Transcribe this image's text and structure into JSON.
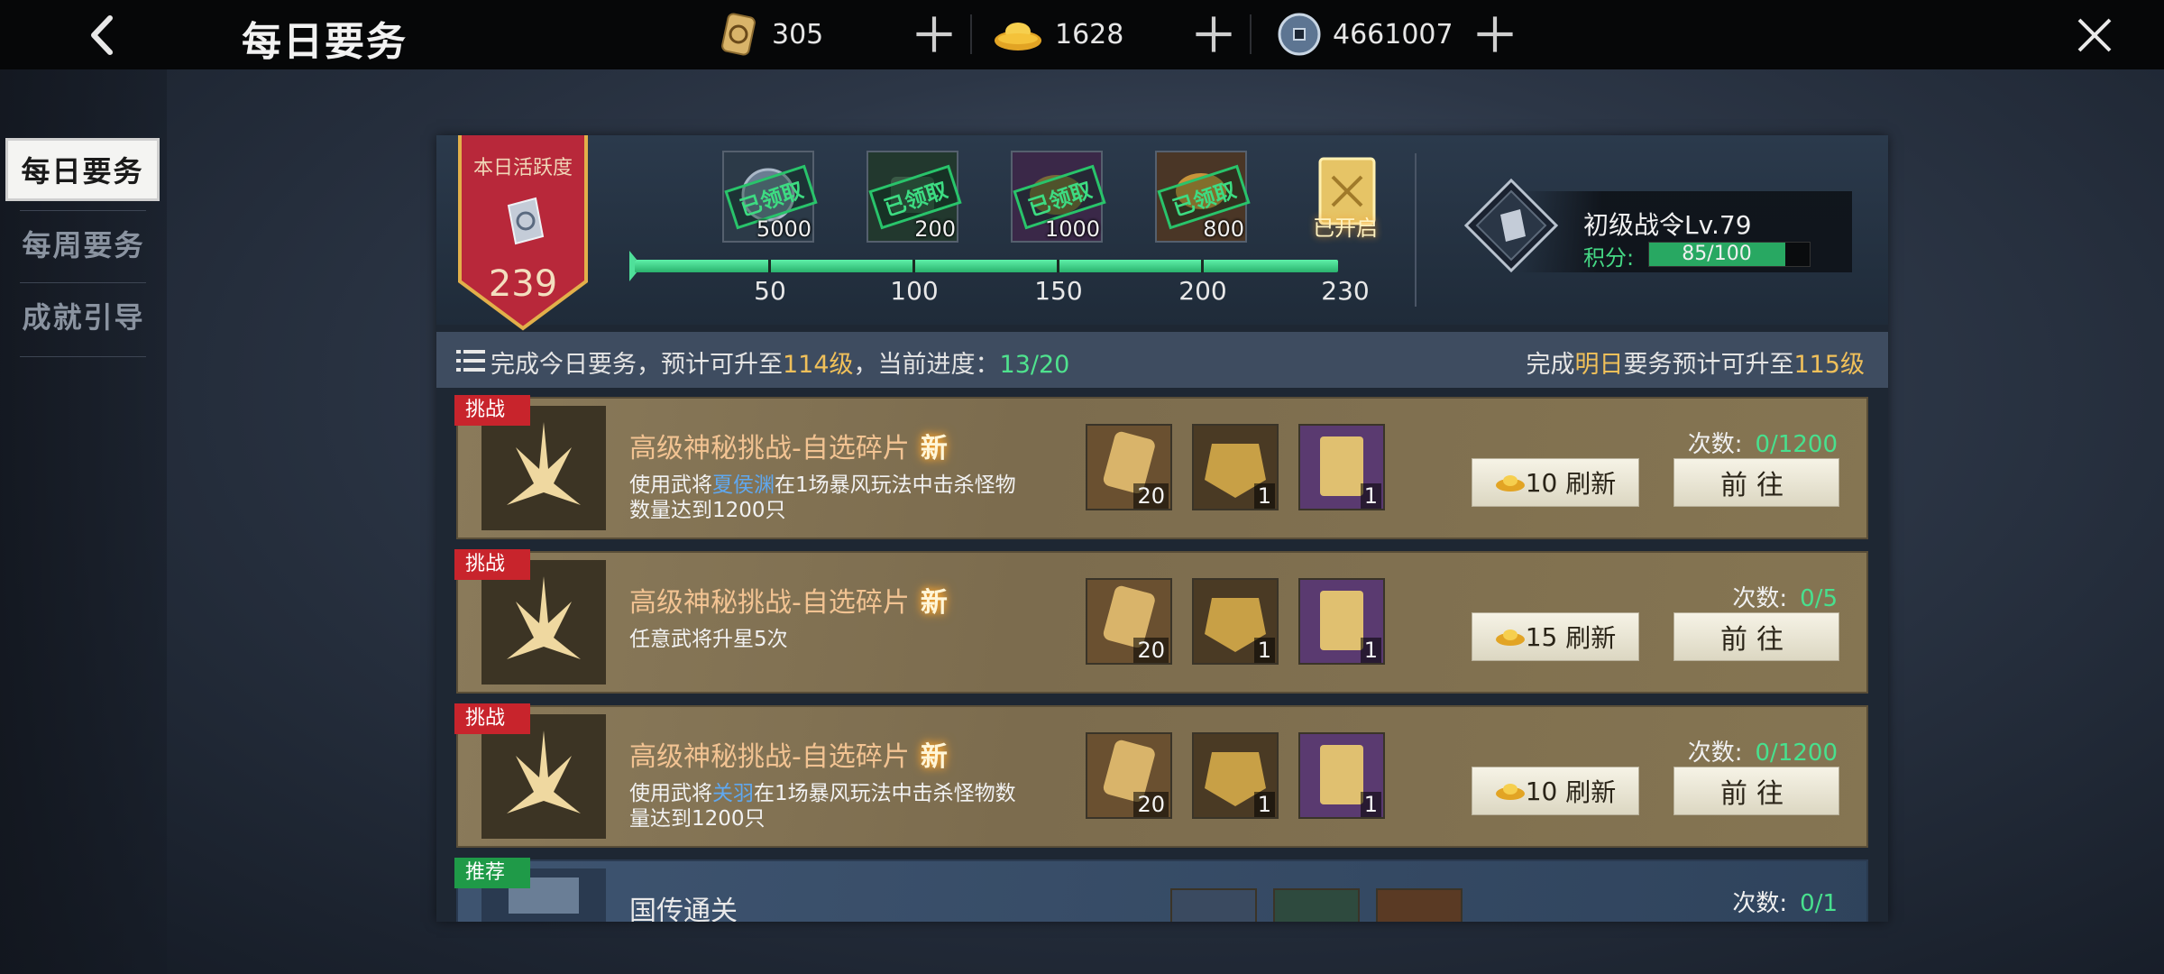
{
  "header": {
    "title": "每日要务",
    "currencies": [
      {
        "icon": "token-icon",
        "value": "305"
      },
      {
        "icon": "gold-ingot-icon",
        "value": "1628"
      },
      {
        "icon": "coin-icon",
        "value": "4661007"
      }
    ]
  },
  "sidebar": {
    "items": [
      {
        "label": "每日要务",
        "active": true
      },
      {
        "label": "每周要务",
        "active": false
      },
      {
        "label": "成就引导",
        "active": false
      }
    ]
  },
  "activity": {
    "banner_label": "本日活跃度",
    "value": "239",
    "progress_fraction": 1.0,
    "milestones": [
      {
        "threshold": "50",
        "amount": "5000",
        "status": "已领取"
      },
      {
        "threshold": "100",
        "amount": "200",
        "status": "已领取"
      },
      {
        "threshold": "150",
        "amount": "1000",
        "status": "已领取"
      },
      {
        "threshold": "200",
        "amount": "800",
        "status": "已领取"
      },
      {
        "threshold": "230",
        "amount": "",
        "status": "已开启"
      }
    ]
  },
  "battle_pass": {
    "title": "初级战令Lv.79",
    "score_label": "积分:",
    "score_text": "85/100",
    "score_fraction": 0.85
  },
  "info": {
    "left_a": "完成今日要务，预计可升至",
    "left_level": "114级",
    "left_b": "，当前进度：",
    "left_progress": "13/20",
    "right_a": "完成",
    "right_day": "明日",
    "right_b": "要务预计可升至",
    "right_level": "115级"
  },
  "tasks": [
    {
      "tag": "挑战",
      "title": "高级神秘挑战-自选碎片",
      "new_label": "新",
      "desc_a": "使用武将",
      "desc_hl": "夏侯渊",
      "desc_b": "在1场暴风玩法中击杀怪物数量达到1200只",
      "rewards": [
        "20",
        "1",
        "1"
      ],
      "refresh_cost": "10",
      "refresh_label": "刷新",
      "go_label": "前往",
      "count_label": "次数:",
      "count_value": "0/1200"
    },
    {
      "tag": "挑战",
      "title": "高级神秘挑战-自选碎片",
      "new_label": "新",
      "desc_a": "任意武将升星5次",
      "desc_hl": "",
      "desc_b": "",
      "rewards": [
        "20",
        "1",
        "1"
      ],
      "refresh_cost": "15",
      "refresh_label": "刷新",
      "go_label": "前往",
      "count_label": "次数:",
      "count_value": "0/5"
    },
    {
      "tag": "挑战",
      "title": "高级神秘挑战-自选碎片",
      "new_label": "新",
      "desc_a": "使用武将",
      "desc_hl": "关羽",
      "desc_b": "在1场暴风玩法中击杀怪物数量达到1200只",
      "rewards": [
        "20",
        "1",
        "1"
      ],
      "refresh_cost": "10",
      "refresh_label": "刷新",
      "go_label": "前往",
      "count_label": "次数:",
      "count_value": "0/1200"
    },
    {
      "tag": "推荐",
      "title": "国传通关",
      "count_label": "次数:",
      "count_value": "0/1"
    }
  ],
  "colors": {
    "accent_gold": "#f0c05a",
    "accent_green": "#48e08e",
    "tag_red": "#c8242c",
    "tag_green": "#1f9a48",
    "highlight_blue": "#5fa8f0"
  }
}
